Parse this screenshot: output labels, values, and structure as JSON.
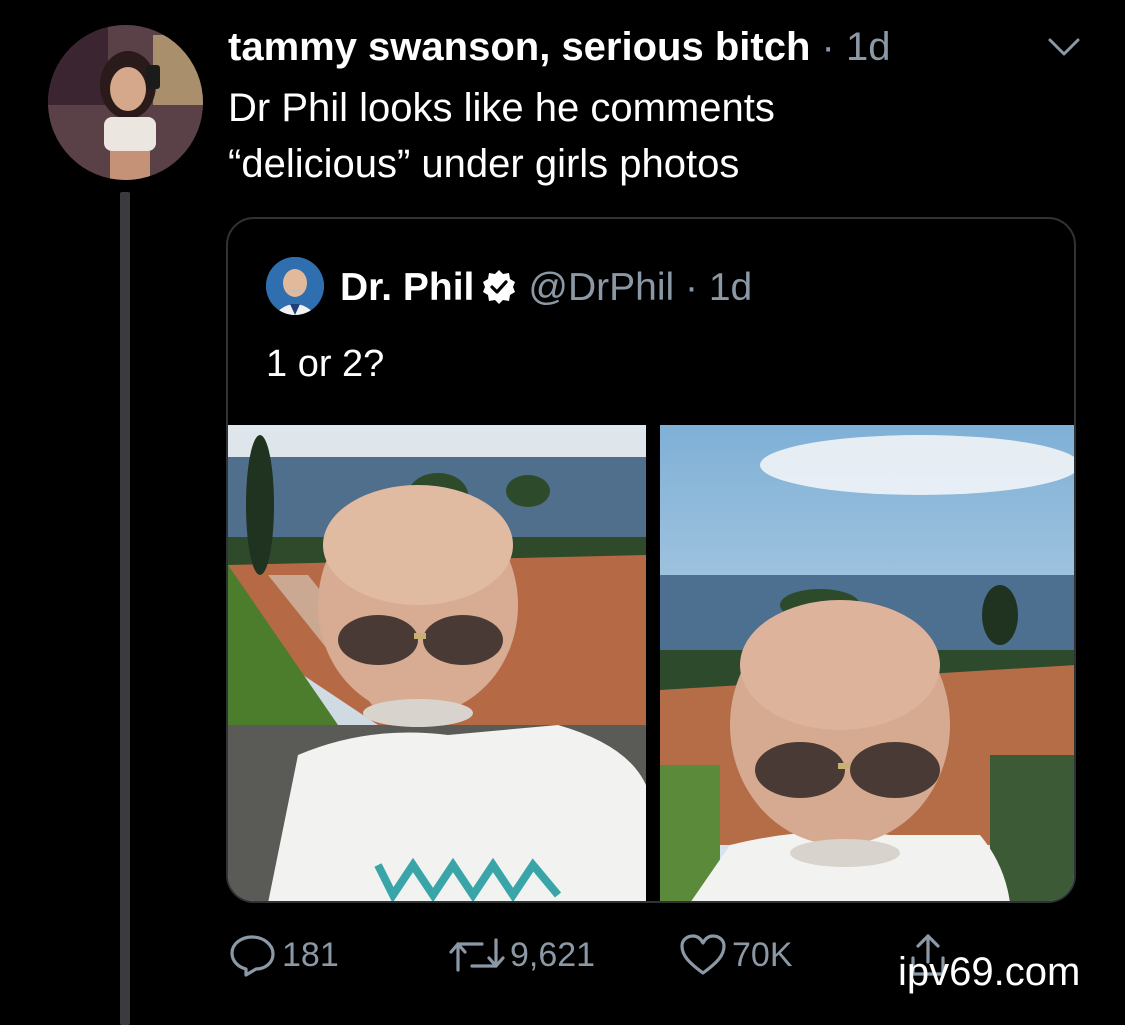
{
  "tweet": {
    "author_name": "tammy swanson, serious bitch",
    "separator": "·",
    "time": "1d",
    "text_line1": "Dr Phil looks like he comments",
    "text_line2": "“delicious” under girls photos",
    "menu_icon": "chevron-down-icon"
  },
  "quoted": {
    "author_name": "Dr. Phil",
    "verified_icon": "verified-badge-icon",
    "handle": "@DrPhil",
    "separator": "·",
    "time": "1d",
    "text": "1 or 2?",
    "photos": [
      "photo-1",
      "photo-2"
    ]
  },
  "actions": {
    "replies": "181",
    "retweets": "9,621",
    "likes": "70K",
    "share_icon": "share-icon"
  },
  "watermark": "ipv69.com",
  "colors": {
    "background": "#000000",
    "text": "#ffffff",
    "secondary": "#8b98a5",
    "border": "#2f3336"
  }
}
